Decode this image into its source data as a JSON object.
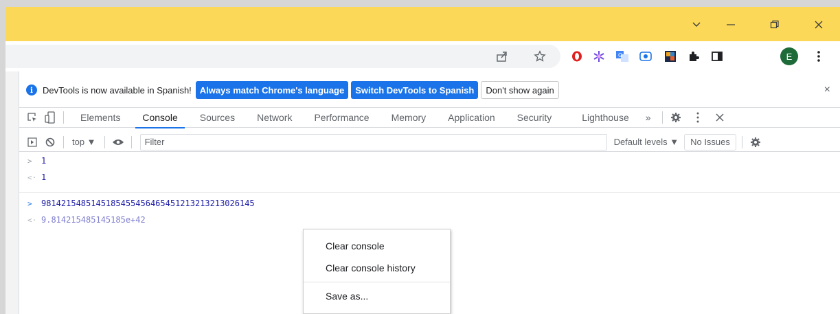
{
  "devtools": {
    "infobar": {
      "message": "DevTools is now available in Spanish!",
      "match_button": "Always match Chrome's language",
      "switch_button": "Switch DevTools to Spanish",
      "dismiss_button": "Don't show again",
      "close": "×"
    },
    "tabs": [
      "Elements",
      "Console",
      "Sources",
      "Network",
      "Performance",
      "Memory",
      "Application",
      "Security",
      "Lighthouse"
    ],
    "active_tab": "Console",
    "more_tabs": "»",
    "filter": {
      "context": "top ▼",
      "placeholder": "Filter",
      "levels": "Default levels ▼",
      "issues": "No Issues"
    },
    "console_lines": [
      {
        "kind": "input",
        "glyph": ">",
        "text": "1"
      },
      {
        "kind": "output",
        "glyph": "<·",
        "text": "1"
      },
      {
        "kind": "input",
        "glyph": ">",
        "text": "9814215485145185455456465451213213213026145"
      },
      {
        "kind": "output",
        "glyph": "<·",
        "text": "9.814215485145185e+42"
      }
    ]
  },
  "profile": {
    "initial": "E"
  },
  "context_menu": {
    "items": [
      "Clear console",
      "Clear console history",
      "Save as..."
    ]
  },
  "colors": {
    "titlebar": "#fcd858",
    "accent": "#1a73e8"
  }
}
